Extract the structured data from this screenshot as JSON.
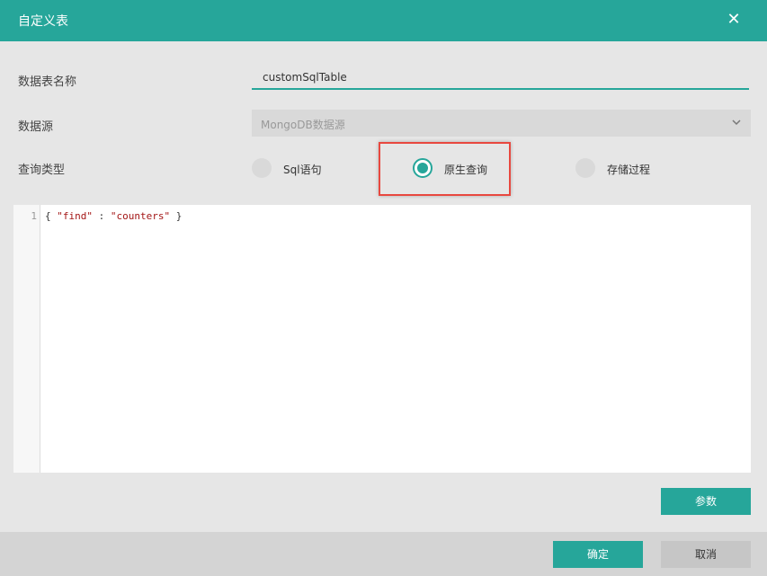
{
  "dialog": {
    "title": "自定义表",
    "close_icon": "close-icon"
  },
  "form": {
    "table_name_label": "数据表名称",
    "table_name_value": "customSqlTable",
    "datasource_label": "数据源",
    "datasource_value": "MongoDB数据源",
    "query_type_label": "查询类型",
    "query_types": [
      {
        "label": "Sql语句",
        "selected": false
      },
      {
        "label": "原生查询",
        "selected": true
      },
      {
        "label": "存储过程",
        "selected": false
      }
    ]
  },
  "editor": {
    "line_number": "1",
    "code_open": "{ ",
    "code_key": "\"find\"",
    "code_sep": " : ",
    "code_value": "\"counters\"",
    "code_close": " }"
  },
  "buttons": {
    "params_label": "参数",
    "ok_label": "确定",
    "cancel_label": "取消"
  },
  "colors": {
    "accent": "#26a69a",
    "highlight_border": "#e8483f"
  }
}
